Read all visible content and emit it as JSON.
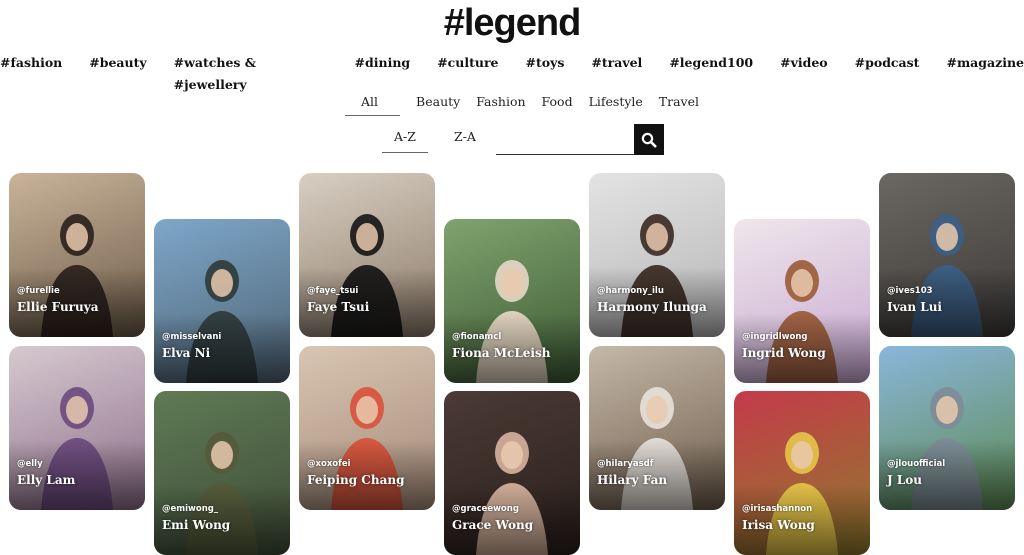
{
  "logo": "#legend",
  "nav": [
    "#fashion",
    "#beauty",
    "#watches & #jewellery",
    "#dining",
    "#culture",
    "#toys",
    "#travel",
    "#legend100",
    "#video",
    "#podcast",
    "#magazine"
  ],
  "filters": [
    "All",
    "Beauty",
    "Fashion",
    "Food",
    "Lifestyle",
    "Travel"
  ],
  "sort": [
    "A-Z",
    "Z-A"
  ],
  "search": {
    "placeholder": ""
  },
  "icons": {
    "search": "search-icon"
  },
  "cards": [
    {
      "handle": "@furellie",
      "name": "Ellie Furuya",
      "bg": [
        "#c9b49a",
        "#6d5a48"
      ],
      "fig": "#2b211c"
    },
    {
      "handle": "@misselvani",
      "name": "Elva Ni",
      "bg": [
        "#7ea7c9",
        "#4d6272"
      ],
      "fig": "#2e3a3a"
    },
    {
      "handle": "@faye_tsui",
      "name": "Faye Tsui",
      "bg": [
        "#d8cfc3",
        "#8c7a68"
      ],
      "fig": "#151515"
    },
    {
      "handle": "@fionamcl",
      "name": "Fiona McLeish",
      "bg": [
        "#7fa36e",
        "#3d5a34"
      ],
      "fig": "#e8d7c6"
    },
    {
      "handle": "@harmony_ilu",
      "name": "Harmony Ilunga",
      "bg": [
        "#e3e3e3",
        "#b5b5b5"
      ],
      "fig": "#3a2a22"
    },
    {
      "handle": "@ingridlwong",
      "name": "Ingrid Wong",
      "bg": [
        "#efe6ea",
        "#c7a8d2"
      ],
      "fig": "#9a5a36"
    },
    {
      "handle": "@ives103",
      "name": "Ivan Lui",
      "bg": [
        "#6b6762",
        "#3c3a38"
      ],
      "fig": "#3c5f86"
    },
    {
      "handle": "@elly",
      "name": "Elly Lam",
      "bg": [
        "#d7c9cf",
        "#8c6f8a"
      ],
      "fig": "#6b4a7e"
    },
    {
      "handle": "@emiwong_",
      "name": "Emi Wong",
      "bg": [
        "#5f7a55",
        "#3e4c36"
      ],
      "fig": "#545a3a"
    },
    {
      "handle": "@xoxofei",
      "name": "Feiping Chang",
      "bg": [
        "#d9c5b3",
        "#a48a77"
      ],
      "fig": "#d9513a"
    },
    {
      "handle": "@graceewong",
      "name": "Grace Wong",
      "bg": [
        "#4b3a35",
        "#2a1f1c"
      ],
      "fig": "#d8b49e"
    },
    {
      "handle": "@hilaryasdf",
      "name": "Hilary Fan",
      "bg": [
        "#c5b8a7",
        "#6d5c4c"
      ],
      "fig": "#e7e2dc"
    },
    {
      "handle": "@irisashannon",
      "name": "Irisa Wong",
      "bg": [
        "#c53a4a",
        "#8f7c2c"
      ],
      "fig": "#e5c548"
    },
    {
      "handle": "@jlouofficial",
      "name": "J Lou",
      "bg": [
        "#8ab6db",
        "#5d8a52"
      ],
      "fig": "#7d8c97"
    }
  ]
}
